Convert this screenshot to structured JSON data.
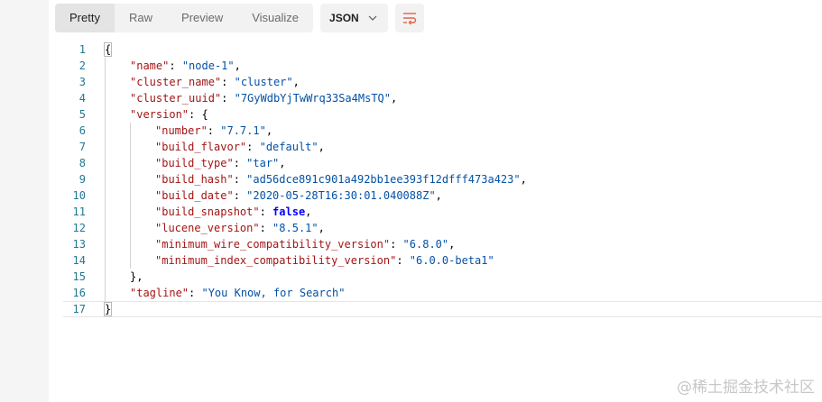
{
  "toolbar": {
    "tabs": [
      {
        "label": "Pretty",
        "active": true
      },
      {
        "label": "Raw",
        "active": false
      },
      {
        "label": "Preview",
        "active": false
      },
      {
        "label": "Visualize",
        "active": false
      }
    ],
    "format": "JSON",
    "wrap_icon": "wrap-lines-icon"
  },
  "code_lines": [
    {
      "num": "1",
      "indent": 0,
      "tokens": [
        {
          "t": "punc",
          "v": "{"
        }
      ]
    },
    {
      "num": "2",
      "indent": 1,
      "tokens": [
        {
          "t": "key",
          "v": "\"name\""
        },
        {
          "t": "punc",
          "v": ": "
        },
        {
          "t": "str",
          "v": "\"node-1\""
        },
        {
          "t": "punc",
          "v": ","
        }
      ]
    },
    {
      "num": "3",
      "indent": 1,
      "tokens": [
        {
          "t": "key",
          "v": "\"cluster_name\""
        },
        {
          "t": "punc",
          "v": ": "
        },
        {
          "t": "str",
          "v": "\"cluster\""
        },
        {
          "t": "punc",
          "v": ","
        }
      ]
    },
    {
      "num": "4",
      "indent": 1,
      "tokens": [
        {
          "t": "key",
          "v": "\"cluster_uuid\""
        },
        {
          "t": "punc",
          "v": ": "
        },
        {
          "t": "str",
          "v": "\"7GyWdbYjTwWrq33Sa4MsTQ\""
        },
        {
          "t": "punc",
          "v": ","
        }
      ]
    },
    {
      "num": "5",
      "indent": 1,
      "tokens": [
        {
          "t": "key",
          "v": "\"version\""
        },
        {
          "t": "punc",
          "v": ": {"
        }
      ]
    },
    {
      "num": "6",
      "indent": 2,
      "tokens": [
        {
          "t": "key",
          "v": "\"number\""
        },
        {
          "t": "punc",
          "v": ": "
        },
        {
          "t": "str",
          "v": "\"7.7.1\""
        },
        {
          "t": "punc",
          "v": ","
        }
      ]
    },
    {
      "num": "7",
      "indent": 2,
      "tokens": [
        {
          "t": "key",
          "v": "\"build_flavor\""
        },
        {
          "t": "punc",
          "v": ": "
        },
        {
          "t": "str",
          "v": "\"default\""
        },
        {
          "t": "punc",
          "v": ","
        }
      ]
    },
    {
      "num": "8",
      "indent": 2,
      "tokens": [
        {
          "t": "key",
          "v": "\"build_type\""
        },
        {
          "t": "punc",
          "v": ": "
        },
        {
          "t": "str",
          "v": "\"tar\""
        },
        {
          "t": "punc",
          "v": ","
        }
      ]
    },
    {
      "num": "9",
      "indent": 2,
      "tokens": [
        {
          "t": "key",
          "v": "\"build_hash\""
        },
        {
          "t": "punc",
          "v": ": "
        },
        {
          "t": "str",
          "v": "\"ad56dce891c901a492bb1ee393f12dfff473a423\""
        },
        {
          "t": "punc",
          "v": ","
        }
      ]
    },
    {
      "num": "10",
      "indent": 2,
      "tokens": [
        {
          "t": "key",
          "v": "\"build_date\""
        },
        {
          "t": "punc",
          "v": ": "
        },
        {
          "t": "str",
          "v": "\"2020-05-28T16:30:01.040088Z\""
        },
        {
          "t": "punc",
          "v": ","
        }
      ]
    },
    {
      "num": "11",
      "indent": 2,
      "tokens": [
        {
          "t": "key",
          "v": "\"build_snapshot\""
        },
        {
          "t": "punc",
          "v": ": "
        },
        {
          "t": "kw",
          "v": "false"
        },
        {
          "t": "punc",
          "v": ","
        }
      ]
    },
    {
      "num": "12",
      "indent": 2,
      "tokens": [
        {
          "t": "key",
          "v": "\"lucene_version\""
        },
        {
          "t": "punc",
          "v": ": "
        },
        {
          "t": "str",
          "v": "\"8.5.1\""
        },
        {
          "t": "punc",
          "v": ","
        }
      ]
    },
    {
      "num": "13",
      "indent": 2,
      "tokens": [
        {
          "t": "key",
          "v": "\"minimum_wire_compatibility_version\""
        },
        {
          "t": "punc",
          "v": ": "
        },
        {
          "t": "str",
          "v": "\"6.8.0\""
        },
        {
          "t": "punc",
          "v": ","
        }
      ]
    },
    {
      "num": "14",
      "indent": 2,
      "tokens": [
        {
          "t": "key",
          "v": "\"minimum_index_compatibility_version\""
        },
        {
          "t": "punc",
          "v": ": "
        },
        {
          "t": "str",
          "v": "\"6.0.0-beta1\""
        }
      ]
    },
    {
      "num": "15",
      "indent": 1,
      "tokens": [
        {
          "t": "punc",
          "v": "},"
        }
      ]
    },
    {
      "num": "16",
      "indent": 1,
      "tokens": [
        {
          "t": "key",
          "v": "\"tagline\""
        },
        {
          "t": "punc",
          "v": ": "
        },
        {
          "t": "str",
          "v": "\"You Know, for Search\""
        }
      ]
    },
    {
      "num": "17",
      "indent": 0,
      "tokens": [
        {
          "t": "punc",
          "v": "}"
        }
      ],
      "current": true
    }
  ],
  "watermark": "@稀土掘金技术社区"
}
